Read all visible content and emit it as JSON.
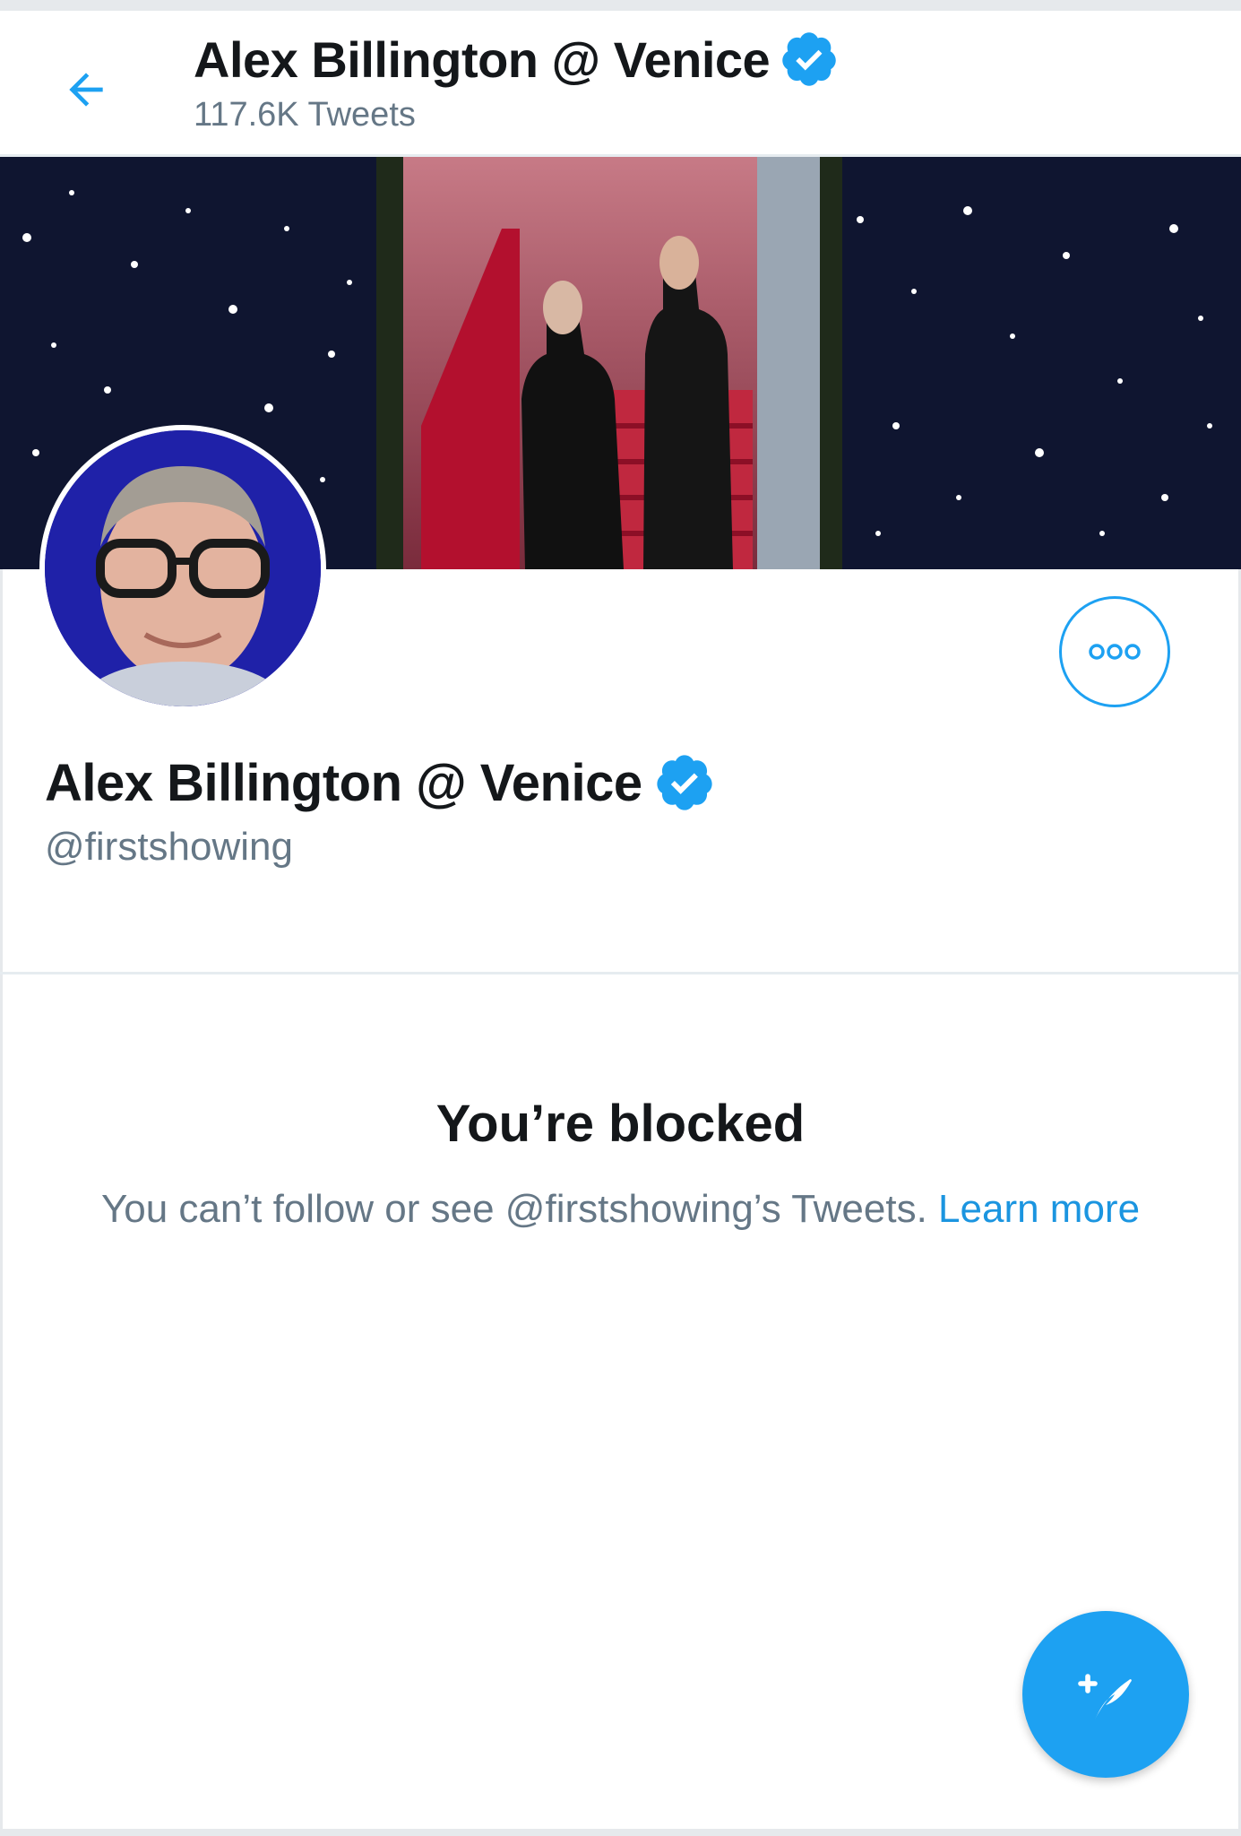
{
  "header": {
    "name": "Alex Billington @ Venice",
    "tweet_count": "117.6K Tweets",
    "back_icon": "arrow-left-icon",
    "verified_icon": "verified-badge-icon"
  },
  "banner": {
    "description_icon": "banner-image"
  },
  "profile": {
    "name": "Alex Billington @ Venice",
    "handle": "@firstshowing",
    "more_icon": "more-options-icon",
    "verified_icon": "verified-badge-icon"
  },
  "blocked": {
    "title": "You’re blocked",
    "message": "You can’t follow or see @firstshowing’s Tweets.",
    "link": "Learn more"
  },
  "compose": {
    "icon": "compose-tweet-icon"
  },
  "colors": {
    "accent": "#1da1f2",
    "link": "#1b95e0",
    "text_primary": "#14171a",
    "text_secondary": "#657786"
  }
}
